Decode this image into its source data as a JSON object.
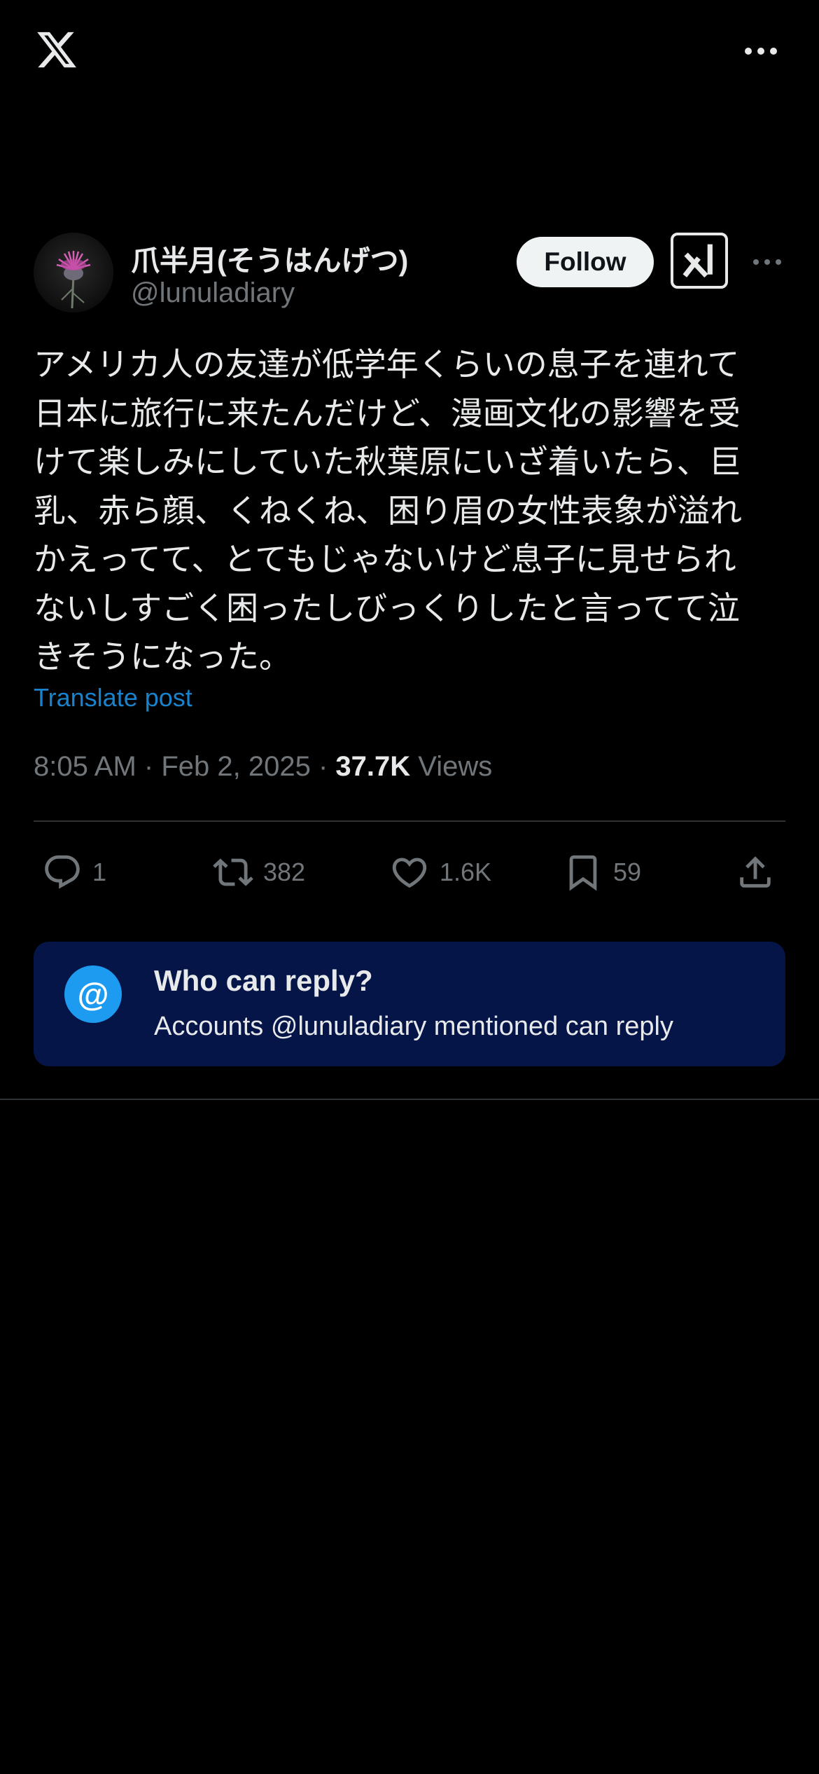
{
  "header": {
    "logo_icon": "x-logo-icon",
    "more_icon": "more-horizontal-icon"
  },
  "author": {
    "display_name": "爪半月(そうはんげつ)",
    "handle": "@lunuladiary",
    "avatar_icon": "flower-avatar",
    "follow_label": "Follow",
    "grok_icon": "grok-icon",
    "more_icon": "more-horizontal-icon"
  },
  "post": {
    "text": "アメリカ人の友達が低学年くらいの息子を連れて\n日本に旅行に来たんだけど、漫画文化の影響を受\nけて楽しみにしていた秋葉原にいざ着いたら、巨\n乳、赤ら顔、くねくね、困り眉の女性表象が溢れ\nかえってて、とてもじゃないけど息子に見せられ\nないしすごく困ったしびっくりしたと言ってて泣\nきそうになった。",
    "translate_label": "Translate post",
    "time": "8:05 AM",
    "date": "Feb 2, 2025",
    "separator": "·",
    "views_count": "37.7K",
    "views_label": "Views"
  },
  "actions": {
    "replies": "1",
    "reposts": "382",
    "likes": "1.6K",
    "bookmarks": "59"
  },
  "reply_restriction": {
    "icon_label": "@",
    "title": "Who can reply?",
    "description": "Accounts @lunuladiary mentioned can reply"
  },
  "colors": {
    "background": "#000000",
    "text_primary": "#e7e9ea",
    "text_secondary": "#71767b",
    "accent": "#1d9bf0",
    "card_background": "#051548",
    "divider": "#2f3336"
  }
}
